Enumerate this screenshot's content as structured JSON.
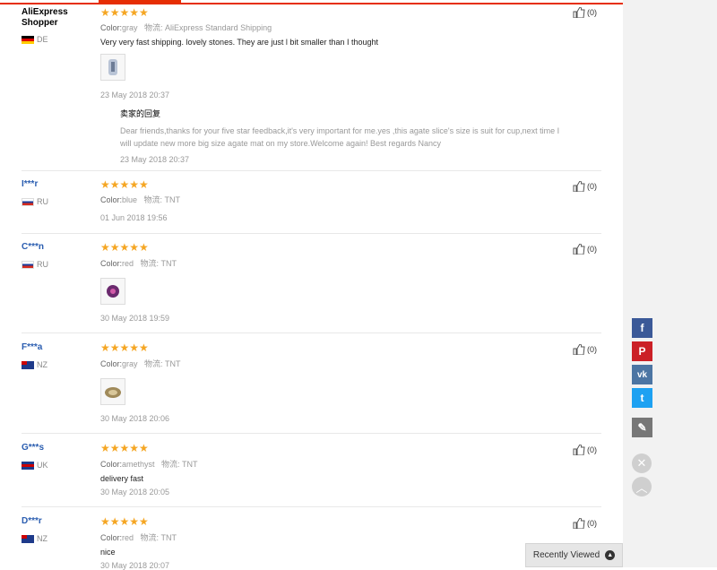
{
  "reviews": [
    {
      "user": "AliExpress Shopper",
      "country": "DE",
      "color_label": "Color:",
      "color": "gray",
      "shipping": "物流: AliExpress Standard Shipping",
      "text": "Very very fast shipping. lovely stones. They are just l bit smaller than I thought",
      "date": "23 May 2018 20:37",
      "likes": "(0)",
      "reply": {
        "title": "卖家的回复",
        "text1": "Dear friends,thanks for your five star feedback,it's very important for me.yes ,this agate slice's size is suit for cup,next time I",
        "text2": "will update new more big size agate mat on my store.Welcome again! Best regards Nancy",
        "date": "23 May 2018 20:37"
      }
    },
    {
      "user": "I***r",
      "country": "RU",
      "color_label": "Color:",
      "color": "blue",
      "shipping": "物流: TNT",
      "date": "01 Jun 2018 19:56",
      "likes": "(0)"
    },
    {
      "user": "C***n",
      "country": "RU",
      "color_label": "Color:",
      "color": "red",
      "shipping": "物流: TNT",
      "date": "30 May 2018 19:59",
      "likes": "(0)"
    },
    {
      "user": "F***a",
      "country": "NZ",
      "color_label": "Color:",
      "color": "gray",
      "shipping": "物流: TNT",
      "date": "30 May 2018 20:06",
      "likes": "(0)"
    },
    {
      "user": "G***s",
      "country": "UK",
      "color_label": "Color:",
      "color": "amethyst",
      "shipping": "物流: TNT",
      "text": "delivery fast",
      "date": "30 May 2018 20:05",
      "likes": "(0)"
    },
    {
      "user": "D***r",
      "country": "NZ",
      "color_label": "Color:",
      "color": "red",
      "shipping": "物流: TNT",
      "text": "nice",
      "date": "30 May 2018 20:07",
      "likes": "(0)"
    }
  ],
  "stars": "★★★★★",
  "share": {
    "facebook": "f",
    "pinterest": "P",
    "vk": "vk",
    "twitter": "t",
    "edit": "✎"
  },
  "controls": {
    "close": "✕",
    "up": "︿"
  },
  "recently_viewed": "Recently Viewed",
  "colors": {
    "accent": "#e62e04",
    "star": "#f5a623",
    "facebook": "#3b5998",
    "pinterest": "#cb2027",
    "vk": "#4c75a3",
    "twitter": "#1da1f2",
    "edit": "#777777"
  }
}
